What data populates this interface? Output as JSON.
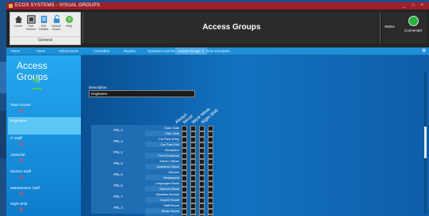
{
  "window": {
    "title": "ECOX SYSTEMS - VISUAL GROUPS",
    "controls": "_ □ ×"
  },
  "ribbon": {
    "buttons": [
      {
        "label": "Home",
        "icon": "home-icon"
      },
      {
        "label": "Full Screen",
        "icon": "fullscreen-icon"
      },
      {
        "label": "Exit Details",
        "icon": "document-icon"
      },
      {
        "label": "Unlock Doors",
        "icon": "unlock-icon"
      },
      {
        "label": "Help",
        "icon": "help-icon"
      }
    ],
    "group_label": "General"
  },
  "page_title": "Access Groups",
  "status": {
    "label": "Status",
    "value": "Connected",
    "color": "#24b23a"
  },
  "tabs": [
    {
      "label": "Home"
    },
    {
      "label": "Users"
    },
    {
      "label": "Unlock Doors"
    },
    {
      "label": "Controllers"
    },
    {
      "label": "Reports"
    },
    {
      "label": "Operators And Permissions"
    },
    {
      "label": "Access Groups",
      "active": true
    },
    {
      "label": "Time Schedules"
    }
  ],
  "sidebar": {
    "title": "Access Groups",
    "add_symbol": "+",
    "groups": [
      {
        "name": "Total Access"
      },
      {
        "name": "Engineers",
        "selected": true
      },
      {
        "name": "IT Staff"
      },
      {
        "name": "Janitorial"
      },
      {
        "name": "Kitchen Staff"
      },
      {
        "name": "Maintenance Staff"
      },
      {
        "name": "Night Shift"
      }
    ],
    "delete_symbol": "✕"
  },
  "form": {
    "description_label": "Description",
    "description_value": "Engineers"
  },
  "columns": [
    "Always",
    "Never",
    "Work Week",
    "Night Shift"
  ],
  "rows": [
    {
      "period": "PRL 3",
      "doors": [
        "Main Gate",
        "Side Gate"
      ]
    },
    {
      "period": "PRL 4",
      "doors": [
        "Car Park Entry",
        "Car Park Exit"
      ]
    },
    {
      "period": "PRL 2",
      "doors": [
        "Reception",
        "Front Entrance"
      ]
    },
    {
      "period": "PRL 5",
      "doors": [
        "Admin Offices",
        "Academic Block"
      ]
    },
    {
      "period": "PRL 6",
      "doors": [
        "Kitchen",
        "Restaurant"
      ]
    },
    {
      "period": "PRL 8",
      "doors": [
        "Languages Block",
        "Science Block"
      ]
    },
    {
      "period": "PRL 7",
      "doors": [
        "Disabled Access",
        "Guard House"
      ]
    },
    {
      "period": "PRL 3",
      "doors": [
        "Staff Room",
        "Music Room"
      ]
    },
    {
      "period": "",
      "doors": [
        "Library"
      ]
    }
  ]
}
